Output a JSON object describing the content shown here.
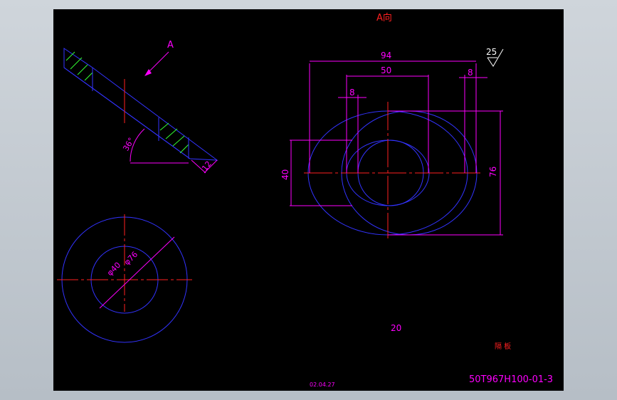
{
  "drawing": {
    "view_label": "A向",
    "arrow_label": "A",
    "roughness": "25",
    "dims": {
      "d94": "94",
      "d50": "50",
      "d8_left": "8",
      "d8_right": "8",
      "d40": "40",
      "d76": "76",
      "angle": "36°",
      "thickness": "12",
      "dia40": "φ40",
      "dia76": "φ76"
    },
    "scale_note": "20",
    "part_name": "隔 板",
    "date": "02.04.27",
    "drawing_number": "50T967H100-01-3"
  },
  "colors": {
    "background": "#000000",
    "outline": "#3333ff",
    "center": "#ff2020",
    "dimension": "#ff00ff",
    "hatch": "#33ff33",
    "frame": "#c0c7ce"
  }
}
